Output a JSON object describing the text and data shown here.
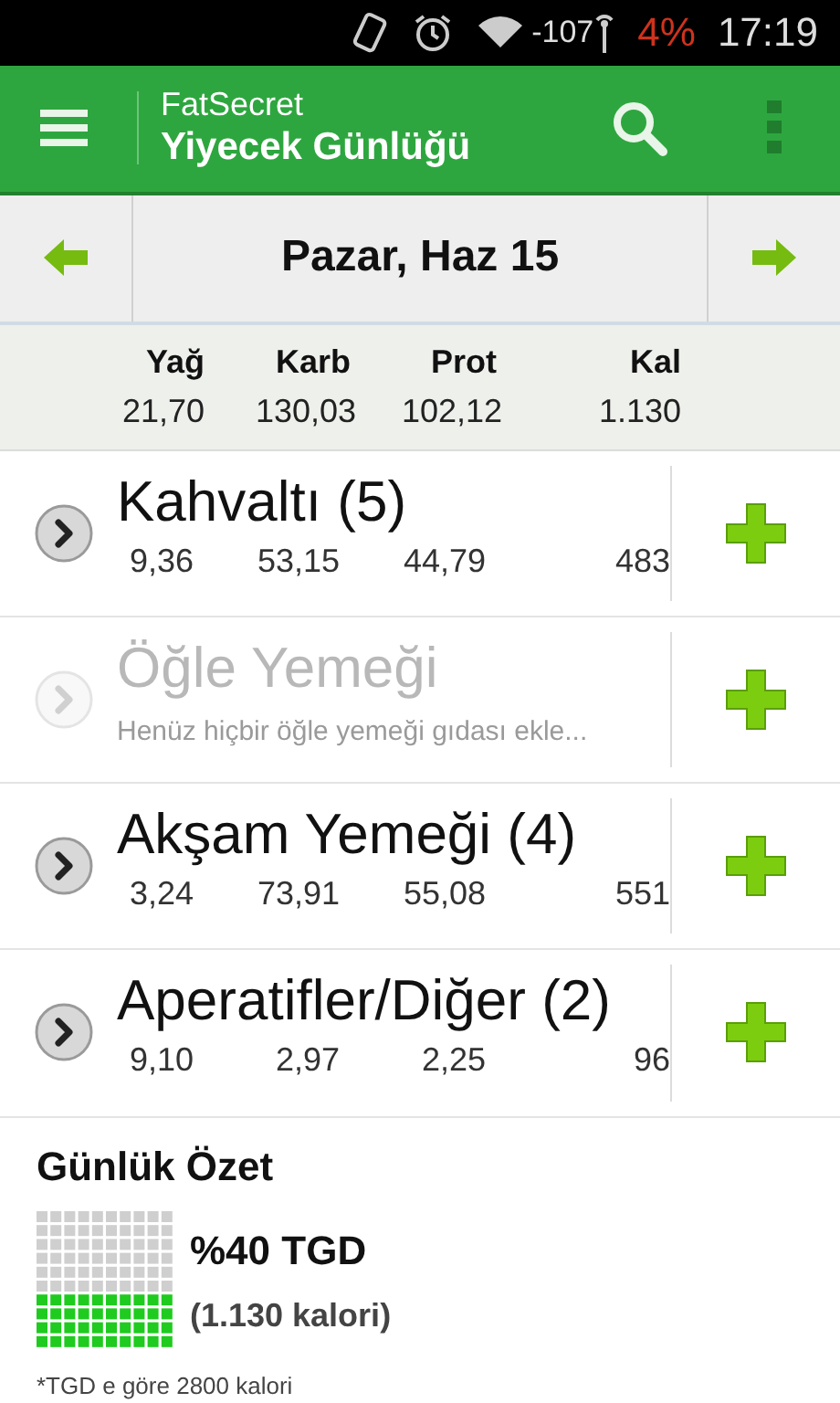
{
  "status_bar": {
    "signal": "-107",
    "battery": "4%",
    "time": "17:19"
  },
  "app_bar": {
    "app_name": "FatSecret",
    "title": "Yiyecek Günlüğü"
  },
  "date_bar": {
    "date": "Pazar, Haz 15"
  },
  "totals": {
    "columns": [
      "Yağ",
      "Karb",
      "Prot",
      "Kal"
    ],
    "values": [
      "21,70",
      "130,03",
      "102,12",
      "1.130"
    ]
  },
  "meals": [
    {
      "name": "Kahvaltı (5)",
      "disabled": false,
      "values": [
        "9,36",
        "53,15",
        "44,79",
        "483"
      ]
    },
    {
      "name": "Öğle Yemeği",
      "disabled": true,
      "note": "Henüz hiçbir öğle yemeği gıdası ekle..."
    },
    {
      "name": "Akşam Yemeği (4)",
      "disabled": false,
      "values": [
        "3,24",
        "73,91",
        "55,08",
        "551"
      ]
    },
    {
      "name": "Aperatifler/Diğer (2)",
      "disabled": false,
      "values": [
        "9,10",
        "2,97",
        "2,25",
        "96"
      ]
    }
  ],
  "summary": {
    "title": "Günlük Özet",
    "percent": "%40 TGD",
    "calories": "(1.130 kalori)",
    "footnote": "*TGD e göre 2800 kalori"
  }
}
